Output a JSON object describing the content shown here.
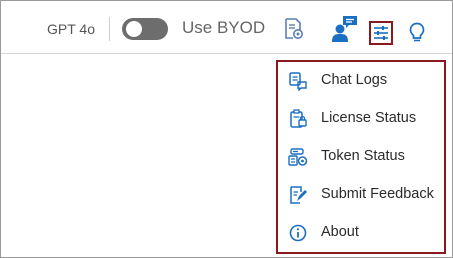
{
  "toolbar": {
    "model_label": "GPT 4o",
    "byod_label": "Use BYOD",
    "byod_enabled": false,
    "icons": [
      "document-settings-icon",
      "user-chat-icon",
      "settings-sliders-icon",
      "lightbulb-icon"
    ]
  },
  "menu": {
    "items": [
      {
        "label": "Chat Logs",
        "icon": "chat-log-icon"
      },
      {
        "label": "License Status",
        "icon": "license-status-icon"
      },
      {
        "label": "Token Status",
        "icon": "token-status-icon"
      },
      {
        "label": "Submit Feedback",
        "icon": "feedback-icon"
      },
      {
        "label": "About",
        "icon": "info-icon"
      }
    ]
  },
  "colors": {
    "accent": "#1b6fc2",
    "highlight_border": "#8a1a1f",
    "toggle_off": "#6d6d6d"
  }
}
